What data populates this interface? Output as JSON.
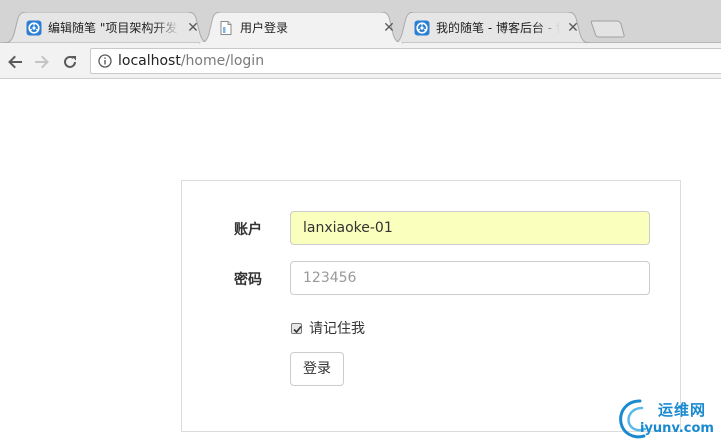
{
  "browser": {
    "tabs": [
      {
        "title": "编辑随笔 \"项目架构开发",
        "favicon": "cnblogs-icon",
        "active": false
      },
      {
        "title": "用户登录",
        "favicon": "page-icon",
        "active": true
      },
      {
        "title": "我的随笔 - 博客后台 - 博",
        "favicon": "cnblogs-icon",
        "active": false
      }
    ],
    "close_glyph": "✕",
    "address": {
      "host": "localhost",
      "path": "/home/login"
    }
  },
  "login": {
    "account_label": "账户",
    "account_value": "lanxiaoke-01",
    "password_label": "密码",
    "password_placeholder": "123456",
    "remember_label": "请记住我",
    "remember_checked": true,
    "submit_label": "登录"
  },
  "watermark": {
    "cn": "运维网",
    "en": "iyunv.com"
  },
  "colors": {
    "autofill_bg": "#faffbd",
    "tabbar_bg": "#d4d4d4",
    "favicon_blue": "#2a7fd4",
    "watermark": "#1a8ad0"
  }
}
